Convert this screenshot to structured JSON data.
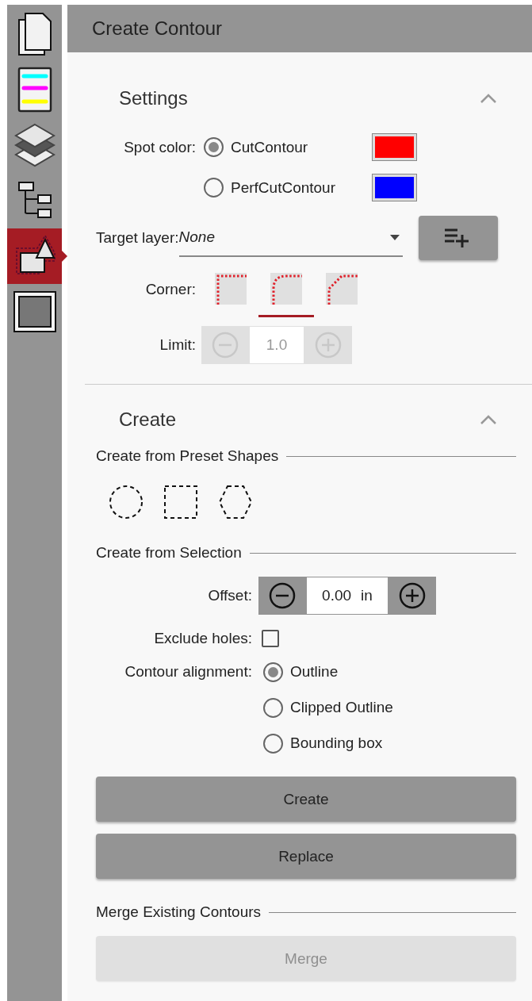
{
  "sidebar": {
    "items": [
      {
        "kind": "pages",
        "selected": false
      },
      {
        "kind": "colors",
        "selected": false
      },
      {
        "kind": "layers",
        "selected": false
      },
      {
        "kind": "tree",
        "selected": false
      },
      {
        "kind": "contour",
        "selected": true
      },
      {
        "kind": "frame",
        "selected": false
      }
    ]
  },
  "header": {
    "title": "Create Contour"
  },
  "settings": {
    "title": "Settings",
    "expanded": true,
    "spot_color": {
      "label": "Spot color:",
      "options": [
        {
          "label": "CutContour",
          "selected": true,
          "color": "#ff0000"
        },
        {
          "label": "PerfCutContour",
          "selected": false,
          "color": "#0000ff"
        }
      ]
    },
    "target_layer": {
      "label": "Target layer:",
      "value": "None"
    },
    "corner": {
      "label": "Corner:",
      "options": [
        {
          "kind": "square",
          "selected": false
        },
        {
          "kind": "round",
          "selected": true
        },
        {
          "kind": "bevel",
          "selected": false
        }
      ]
    },
    "limit": {
      "label": "Limit:",
      "value": "1.0",
      "disabled": true
    }
  },
  "create": {
    "title": "Create",
    "expanded": true,
    "preset": {
      "title": "Create from Preset Shapes",
      "shapes": [
        {
          "kind": "circle"
        },
        {
          "kind": "square"
        },
        {
          "kind": "hexagon"
        }
      ]
    },
    "selection": {
      "title": "Create from Selection",
      "offset": {
        "label": "Offset:",
        "value": "0.00",
        "unit": "in"
      },
      "exclude_holes": {
        "label": "Exclude holes:",
        "checked": false
      },
      "alignment": {
        "label": "Contour alignment:",
        "options": [
          {
            "label": "Outline",
            "selected": true
          },
          {
            "label": "Clipped Outline",
            "selected": false
          },
          {
            "label": "Bounding box",
            "selected": false
          }
        ]
      },
      "buttons": [
        {
          "label": "Create",
          "disabled": false
        },
        {
          "label": "Replace",
          "disabled": false
        }
      ]
    },
    "merge": {
      "title": "Merge Existing Contours",
      "button": {
        "label": "Merge",
        "disabled": true
      }
    }
  }
}
